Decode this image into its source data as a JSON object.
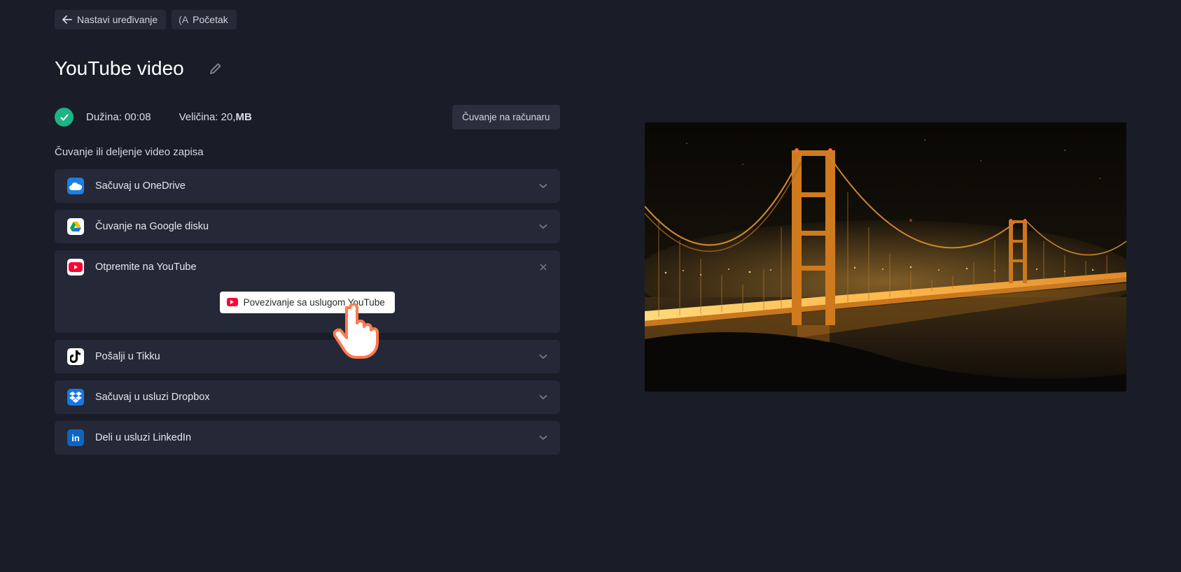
{
  "crumbs": {
    "back": "Nastavi uređivanje",
    "home_prefix": "(A",
    "home": "Početak"
  },
  "title": "YouTube video",
  "meta": {
    "length_label": "Dužina: 00:08",
    "size_label": "Veličina: 20,",
    "size_unit": "MB",
    "save_computer": "Čuvanje na računaru"
  },
  "subheading": "Čuvanje ili deljenje video zapisa",
  "destinations": {
    "onedrive": "Sačuvaj u OneDrive",
    "gdrive": "Čuvanje na Google disku",
    "youtube": "Otpremite na YouTube",
    "tiktok": "Pošalji u Tikku",
    "dropbox": "Sačuvaj u usluzi Dropbox",
    "linkedin": "Deli u usluzi LinkedIn"
  },
  "connect_youtube": "Povezivanje sa uslugom YouTube",
  "linkedin_badge": "in"
}
